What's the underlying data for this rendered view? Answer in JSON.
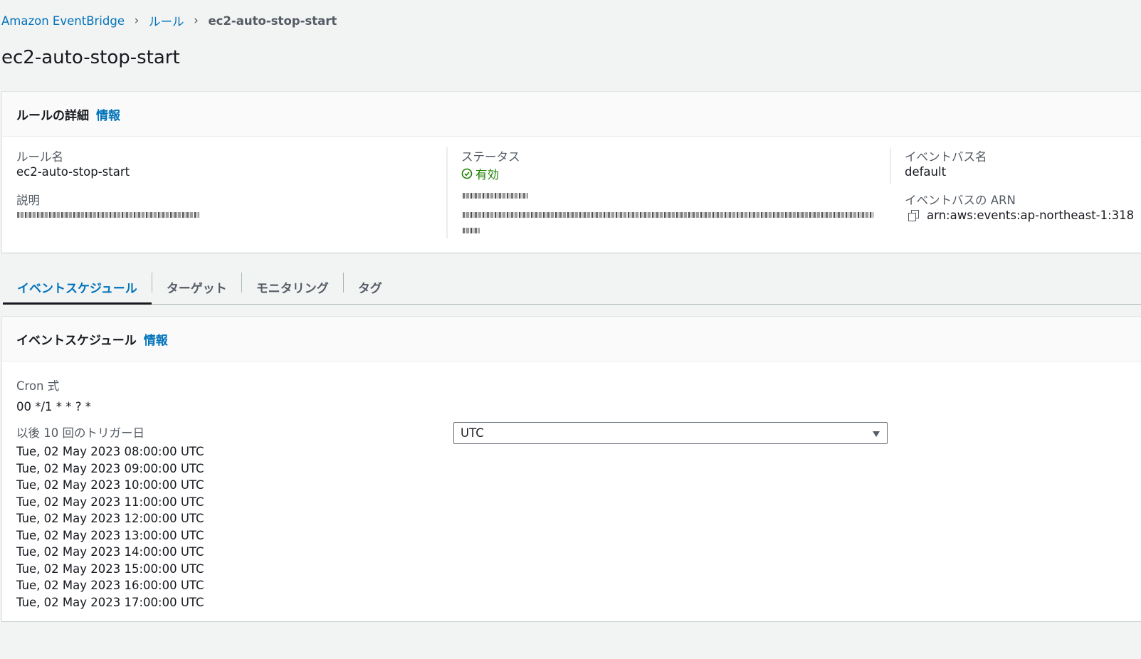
{
  "breadcrumb": {
    "items": [
      "Amazon EventBridge",
      "ルール"
    ],
    "current": "ec2-auto-stop-start"
  },
  "page_title": "ec2-auto-stop-start",
  "details": {
    "title": "ルールの詳細",
    "info": "情報",
    "rule_name_label": "ルール名",
    "rule_name": "ec2-auto-stop-start",
    "description_label": "説明",
    "status_label": "ステータス",
    "status": "有効",
    "event_bus_name_label": "イベントバス名",
    "event_bus_name": "default",
    "event_bus_arn_label": "イベントバスの ARN",
    "event_bus_arn": "arn:aws:events:ap-northeast-1:318"
  },
  "tabs": [
    "イベントスケジュール",
    "ターゲット",
    "モニタリング",
    "タグ"
  ],
  "schedule": {
    "title": "イベントスケジュール",
    "info": "情報",
    "cron_label": "Cron 式",
    "cron_value": "00 */1 * * ? *",
    "next_label": "以後 10 回のトリガー日",
    "triggers": [
      "Tue, 02 May 2023 08:00:00 UTC",
      "Tue, 02 May 2023 09:00:00 UTC",
      "Tue, 02 May 2023 10:00:00 UTC",
      "Tue, 02 May 2023 11:00:00 UTC",
      "Tue, 02 May 2023 12:00:00 UTC",
      "Tue, 02 May 2023 13:00:00 UTC",
      "Tue, 02 May 2023 14:00:00 UTC",
      "Tue, 02 May 2023 15:00:00 UTC",
      "Tue, 02 May 2023 16:00:00 UTC",
      "Tue, 02 May 2023 17:00:00 UTC"
    ],
    "timezone": "UTC"
  },
  "colors": {
    "link": "#0073bb",
    "success": "#1d8102",
    "background": "#f2f3f3"
  },
  "icons": {
    "breadcrumb_separator": "chevron-right-icon",
    "status": "check-circle-icon",
    "copy": "copy-icon",
    "dropdown": "caret-down-icon"
  }
}
